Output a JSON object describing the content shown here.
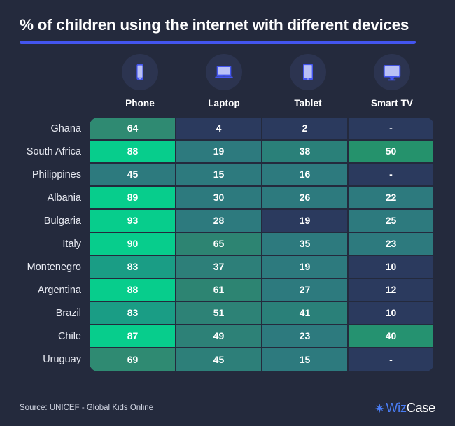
{
  "header": {
    "title": "% of children using the internet with different devices",
    "accent_color": "#4355ef"
  },
  "columns": [
    {
      "label": "Phone",
      "icon": "phone-icon"
    },
    {
      "label": "Laptop",
      "icon": "laptop-icon"
    },
    {
      "label": "Tablet",
      "icon": "tablet-icon"
    },
    {
      "label": "Smart TV",
      "icon": "smart-tv-icon"
    }
  ],
  "footer": {
    "source": "Source: UNICEF - Global Kids Online",
    "logo_wiz": "Wiz",
    "logo_case": "Case",
    "logo_icon": "sparkle-icon"
  },
  "palette": {
    "background": "#242a3d",
    "icon_circle": "#2c3450",
    "icon_accent": "#4355ef",
    "icon_screen": "#b9c0f5",
    "low": "#2b3a5e",
    "mid": "#2d7a7e",
    "high": "#07cd8c"
  },
  "chart_data": {
    "type": "heatmap",
    "title": "% of children using the internet with different devices",
    "xlabel": "",
    "ylabel": "",
    "categories": [
      "Phone",
      "Laptop",
      "Tablet",
      "Smart TV"
    ],
    "rows": [
      "Ghana",
      "South Africa",
      "Philippines",
      "Albania",
      "Bulgaria",
      "Italy",
      "Montenegro",
      "Argentina",
      "Brazil",
      "Chile",
      "Uruguay"
    ],
    "missing_marker": "-",
    "value_range": [
      0,
      93
    ],
    "cells": [
      {
        "row": "Ghana",
        "values": [
          "64",
          "4",
          "2",
          "-"
        ],
        "colors": [
          "#2f8a72",
          "#2b3a5e",
          "#2b3a5e",
          "#2b3a5e"
        ]
      },
      {
        "row": "South Africa",
        "values": [
          "88",
          "19",
          "38",
          "50"
        ],
        "colors": [
          "#07cd8c",
          "#2d7a7e",
          "#2a8079",
          "#25926c"
        ]
      },
      {
        "row": "Philippines",
        "values": [
          "45",
          "15",
          "16",
          "-"
        ],
        "colors": [
          "#2d7a7e",
          "#2d7a7e",
          "#2d7a7e",
          "#2b3a5e"
        ]
      },
      {
        "row": "Albania",
        "values": [
          "89",
          "30",
          "26",
          "22"
        ],
        "colors": [
          "#07cd8c",
          "#2d7a7e",
          "#2d7a7e",
          "#2d7a7e"
        ]
      },
      {
        "row": "Bulgaria",
        "values": [
          "93",
          "28",
          "19",
          "25"
        ],
        "colors": [
          "#07cd8c",
          "#2d7a7e",
          "#2b3a5e",
          "#2d7a7e"
        ]
      },
      {
        "row": "Italy",
        "values": [
          "90",
          "65",
          "35",
          "23"
        ],
        "colors": [
          "#07cd8c",
          "#2d8472",
          "#2d7a7e",
          "#2d7a7e"
        ]
      },
      {
        "row": "Montenegro",
        "values": [
          "83",
          "37",
          "19",
          "10"
        ],
        "colors": [
          "#1a9d85",
          "#2d7f79",
          "#2d7a7e",
          "#2b3a5e"
        ]
      },
      {
        "row": "Argentina",
        "values": [
          "88",
          "61",
          "27",
          "12"
        ],
        "colors": [
          "#07cd8c",
          "#2d8472",
          "#2d7a7e",
          "#2b3a5e"
        ]
      },
      {
        "row": "Brazil",
        "values": [
          "83",
          "51",
          "41",
          "10"
        ],
        "colors": [
          "#1a9d85",
          "#2d8276",
          "#2a8079",
          "#2b3a5e"
        ]
      },
      {
        "row": "Chile",
        "values": [
          "87",
          "49",
          "23",
          "40"
        ],
        "colors": [
          "#07cd8c",
          "#2d8177",
          "#2d7a7e",
          "#259270"
        ]
      },
      {
        "row": "Uruguay",
        "values": [
          "69",
          "45",
          "15",
          "-"
        ],
        "colors": [
          "#2f8a72",
          "#2d7f79",
          "#2d7a7e",
          "#2b3a5e"
        ]
      }
    ]
  }
}
